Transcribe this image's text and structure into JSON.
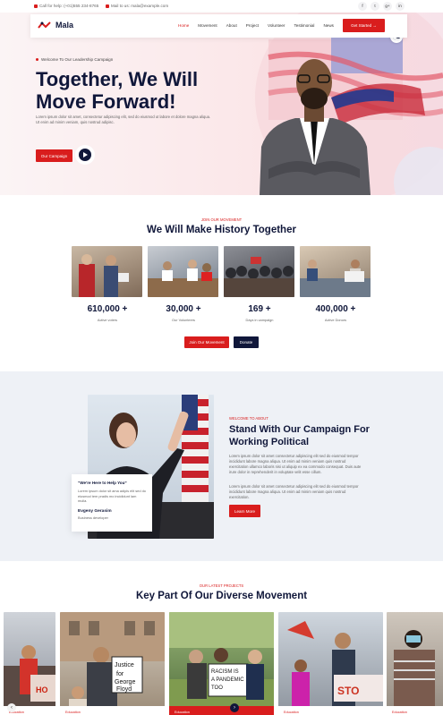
{
  "topbar": {
    "phone": "Call for help: (+01)555 234-8765",
    "email": "Mail to us: mala@example.com",
    "social": [
      "f",
      "t",
      "g+",
      "in"
    ]
  },
  "nav": {
    "brand": "Mala",
    "items": [
      "Home",
      "Movement",
      "About",
      "Project",
      "Volunteer",
      "Testimonial",
      "News"
    ],
    "cta": "Get Started →"
  },
  "hero": {
    "eyebrow": "Welcome To Our Leadership Campaign",
    "title_line1": "Together, We Will",
    "title_line2": "Move Forward!",
    "description": "Lorem ipsum dolor sit amet, consectetur adipiscing elit, sed do eiusmod ut labore et dolore magna aliqua. Ut enim ad minim veniam, quis nostrud adipisc.",
    "cta": "Our Campaign"
  },
  "movement": {
    "eyebrow": "JOIN OUR MOVEMENT",
    "title": "We Will Make History Together",
    "stats": [
      {
        "value": "610,000 +",
        "label": "Active voters"
      },
      {
        "value": "30,000 +",
        "label": "Our Volunteers"
      },
      {
        "value": "169 +",
        "label": "Days in campaign"
      },
      {
        "value": "400,000 +",
        "label": "Active Donors"
      }
    ],
    "join_button": "Join Our Movement",
    "donate_button": "Donate"
  },
  "about": {
    "eyebrow": "WELCOME TO ABOUT",
    "title_line1": "Stand With Our Campaign For",
    "title_line2": "Working Political",
    "para1": "Lorem ipsum dolor sit amet consectetur adipiscing elit sed do eiusmod tempor incididunt labore magna aliqua. Ut enim ad minim veniam quis nostrud exercitation ullamco laboris nisi ut aliquip ex ea commodo consequat. Duis aute irure dolor in reprehenderit in voluptate velit esse cillum.",
    "para2": "Lorem ipsum dolor sit amet consectetur adipiscing elit sed do eiusmod tempor incididunt labore magna aliqua. Ut enim ad minim veniam quis nostrud exercitation.",
    "cta": "Learn More",
    "quote_title": "“We're Here to Help You”",
    "quote_text": "Lorem ipsum dolor sit ama adipis elit sed do eiusmod tem pradis mo incididunt lam mulla.",
    "quote_author": "Evgeny Gerasim",
    "quote_role": "Business developer"
  },
  "projects": {
    "eyebrow": "OUR LATEST PROJECTS",
    "title": "Key Part Of Our Diverse Movement",
    "captions": [
      "Education",
      "Education",
      "Education",
      "Education",
      "Education"
    ]
  },
  "colors": {
    "accent": "#d91d1d",
    "navy": "#10173a",
    "about_bg": "#eef1f6"
  }
}
